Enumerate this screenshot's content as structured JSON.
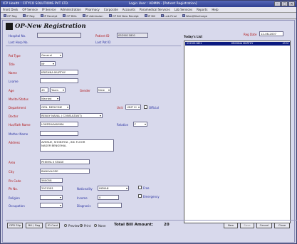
{
  "titlebar": {
    "app_title": "ICP Health : CITYCO SOLUTIONS PVT LTD.",
    "window_title": "Login User : ADMIN - [Patient Registration]"
  },
  "menubar": [
    "Front Desk",
    "OP Service",
    "IP Service",
    "Administration",
    "Pharmacy",
    "Corporate",
    "Accounts",
    "Paramedical Services",
    "Lab Services",
    "Reports",
    "Help"
  ],
  "toolbar": [
    "OP Reg",
    "IP Reg",
    "IP Receipt",
    "OP Bills",
    "IP Admission",
    "OP Bill New Receipt",
    "IP Bill",
    "Lab Final",
    "Ward/Discharge"
  ],
  "form": {
    "title": "OP-New Registration",
    "hospital_no_label": "Hospital No.",
    "hospital_no": "",
    "last_hosp_label": "Last Hosp No.",
    "patient_id_label": "Patient ID",
    "patient_id": "0529011801",
    "last_pat_label": "Last Pat ID",
    "pat_type_label": "Pat Type",
    "pat_type": "General",
    "title_label": "Title",
    "title_value": "Mr",
    "name_label": "Name",
    "name": "KRISHNA MURTHY",
    "lname_label": "Lname",
    "lname": "",
    "age_label": "Age",
    "age": "45",
    "age_unit": "Years",
    "gender_label": "Gender",
    "gender": "Male",
    "marital_label": "Marital Status",
    "marital": "Married",
    "department_label": "Department",
    "department": "GEN. MEDICINE",
    "unit_label": "Unit",
    "unit": "UNIT III",
    "official_label": "Official",
    "doctor_label": "Doctor",
    "doctor": "RENUY NAVAL ( CONSULTANT)",
    "hus_label": "Hus/Fath Name",
    "hus": "LOKESHAVAMMA",
    "relation_label": "Relation",
    "relation": "F",
    "mother_label": "Mother Name",
    "mother": "",
    "address_label": "Address",
    "address": "AVENUE, SHOBITHA , 8th FLOOR",
    "address2": "NAGER BENGEHAL",
    "area_label": "Area",
    "area": "PEENYA II STAGE",
    "city_label": "City",
    "city": "BANGALORE",
    "pin_label": "Pin Code",
    "pin": "560058",
    "ph_label": "Ph No.",
    "ph": "2931581",
    "nationality_label": "Nationality",
    "nationality": "INDIAN",
    "free_label": "Free",
    "religion_label": "Religion",
    "religion": "",
    "income_label": "Income",
    "income": "0",
    "emergency_label": "Emergency",
    "occupation_label": "Occupation",
    "occupation": "",
    "diagnosis_label": "Diagnosis"
  },
  "today": {
    "label": "Today's List",
    "reg_date_label": "Reg Date",
    "reg_date": "12-06-2007",
    "row_id": "0529011801",
    "row_name": "KRISHNA MURTHY",
    "row_age": "45 M"
  },
  "bottom": {
    "opd_slip": "OPD Slip",
    "bill_reg": "Bill / Reg",
    "id_card": "ID Card",
    "preview": "Preview",
    "print": "Print",
    "none": "None",
    "total_label": "Total Bill Amount:",
    "total_value": "20",
    "new": "New",
    "save": "Save",
    "cancel": "Cancel",
    "close": "Close"
  }
}
